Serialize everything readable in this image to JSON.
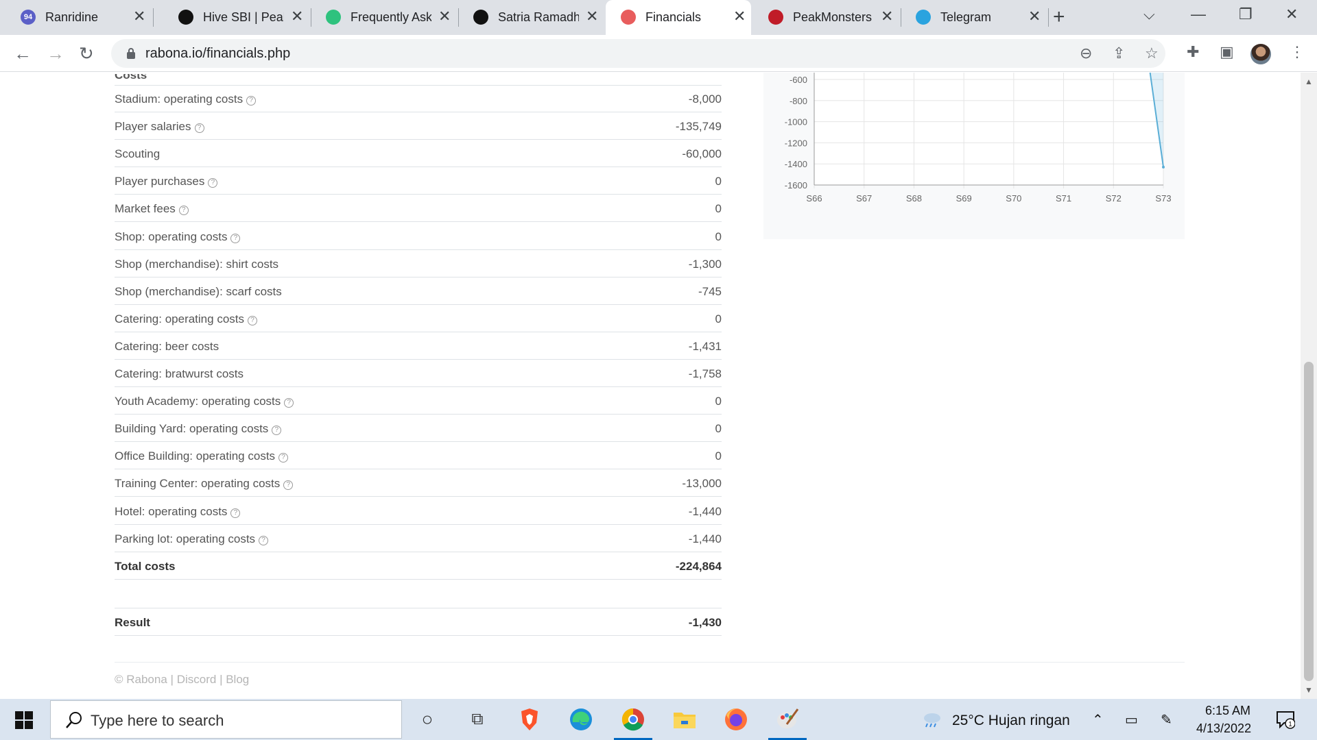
{
  "browser": {
    "tabs": [
      {
        "title": "Ranridine",
        "favicon_color": "#5b5fc7",
        "badge": "94",
        "left": 0
      },
      {
        "title": "Hive SBI | Peak",
        "favicon_color": "#111111",
        "left": 230
      },
      {
        "title": "Frequently Ask",
        "favicon_color": "#2ec27e",
        "left": 445
      },
      {
        "title": "Satria Ramadh",
        "favicon_color": "#111111",
        "left": 660
      },
      {
        "title": "Financials",
        "favicon_color": "#e85d5d",
        "left": 875,
        "active": true
      },
      {
        "title": "PeakMonsters",
        "favicon_color": "#c01c28",
        "left": 1090
      },
      {
        "title": "Telegram",
        "favicon_color": "#2aa3df",
        "left": 1305
      }
    ],
    "url": "rabona.io/financials.php"
  },
  "costs": {
    "top_cut_label": "Costs",
    "rows": [
      {
        "label": "Stadium: operating costs",
        "help": true,
        "value": "-8,000"
      },
      {
        "label": "Player salaries",
        "help": true,
        "value": "-135,749"
      },
      {
        "label": "Scouting",
        "help": false,
        "value": "-60,000"
      },
      {
        "label": "Player purchases",
        "help": true,
        "value": "0"
      },
      {
        "label": "Market fees",
        "help": true,
        "value": "0"
      },
      {
        "label": "Shop: operating costs",
        "help": true,
        "value": "0"
      },
      {
        "label": "Shop (merchandise): shirt costs",
        "help": false,
        "value": "-1,300"
      },
      {
        "label": "Shop (merchandise): scarf costs",
        "help": false,
        "value": "-745"
      },
      {
        "label": "Catering: operating costs",
        "help": true,
        "value": "0"
      },
      {
        "label": "Catering: beer costs",
        "help": false,
        "value": "-1,431"
      },
      {
        "label": "Catering: bratwurst costs",
        "help": false,
        "value": "-1,758"
      },
      {
        "label": "Youth Academy: operating costs",
        "help": true,
        "value": "0"
      },
      {
        "label": "Building Yard: operating costs",
        "help": true,
        "value": "0"
      },
      {
        "label": "Office Building: operating costs",
        "help": true,
        "value": "0"
      },
      {
        "label": "Training Center: operating costs",
        "help": true,
        "value": "-13,000"
      },
      {
        "label": "Hotel: operating costs",
        "help": true,
        "value": "-1,440"
      },
      {
        "label": "Parking lot: operating costs",
        "help": true,
        "value": "-1,440"
      }
    ],
    "total_label": "Total costs",
    "total_value": "-224,864",
    "result_label": "Result",
    "result_value": "-1,430"
  },
  "chart_data": {
    "type": "line",
    "x": [
      "S66",
      "S67",
      "S68",
      "S69",
      "S70",
      "S71",
      "S72",
      "S73"
    ],
    "yticks": [
      -600,
      -800,
      -1000,
      -1200,
      -1400,
      -1600
    ],
    "ylim": [
      -1600,
      -600
    ],
    "series": [
      {
        "values": [
          null,
          null,
          null,
          null,
          null,
          null,
          null,
          -1430
        ],
        "visible_start": -500
      }
    ],
    "color": "#5aaed6"
  },
  "footer": {
    "copyright": "© Rabona",
    "links": [
      "Discord",
      "Blog"
    ],
    "sep": "|"
  },
  "taskbar": {
    "search_placeholder": "Type here to search",
    "weather": "25°C  Hujan ringan",
    "time": "6:15 AM",
    "date": "4/13/2022",
    "notifications": "1"
  }
}
